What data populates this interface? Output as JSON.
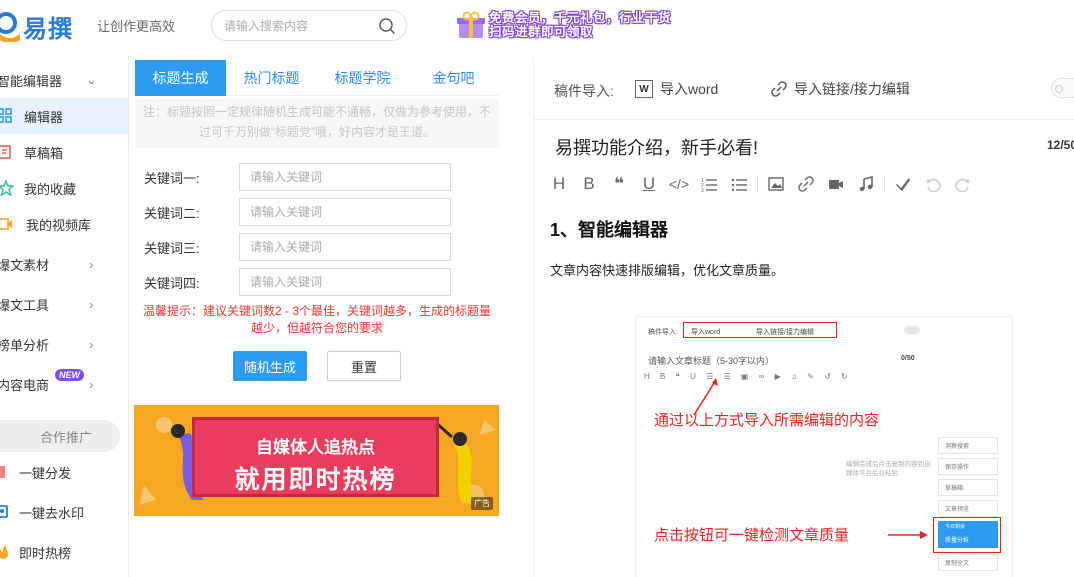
{
  "header": {
    "logo_text": "易撰",
    "slogan": "让创作更高效",
    "search_placeholder": "请输入搜索内容",
    "promo_line1": "免费会员，千元礼包，行业干货",
    "promo_line2": "扫码进群即可领取"
  },
  "sidebar": {
    "items": [
      {
        "label": "智能编辑器"
      },
      {
        "label": "编辑器"
      },
      {
        "label": "草稿箱"
      },
      {
        "label": "我的收藏"
      },
      {
        "label": "我的视频库"
      },
      {
        "label": "爆文素材"
      },
      {
        "label": "爆文工具"
      },
      {
        "label": "榜单分析"
      },
      {
        "label": "内容电商"
      }
    ],
    "new_badge": "NEW",
    "coop_label": "合作推广",
    "promo_items": [
      {
        "label": "一键分发"
      },
      {
        "label": "一键去水印"
      },
      {
        "label": "即时热榜"
      }
    ]
  },
  "title_tool": {
    "tabs": [
      {
        "label": "标题生成"
      },
      {
        "label": "热门标题"
      },
      {
        "label": "标题学院"
      },
      {
        "label": "金句吧"
      }
    ],
    "notice": "注：标题按照一定规律随机生成可能不通畅，仅做为参考使用，不过可千万别做“标题党”哦，好内容才是王道。",
    "keywords": [
      {
        "label": "关键词一:",
        "placeholder": "请输入关键词"
      },
      {
        "label": "关键词二:",
        "placeholder": "请输入关键词"
      },
      {
        "label": "关键词三:",
        "placeholder": "请输入关键词"
      },
      {
        "label": "关键词四:",
        "placeholder": "请输入关键词"
      }
    ],
    "tip": "温馨提示：建议关键词数2 - 3个最佳，关键词越多，生成的标题量越少，但越符合您的要求",
    "generate_label": "随机生成",
    "reset_label": "重置"
  },
  "ad": {
    "line1": "自媒体人追热点",
    "line2": "就用即时热榜",
    "tag": "广告"
  },
  "editor": {
    "import_label": "稿件导入:",
    "word_icon": "W",
    "word_label": "导入word",
    "link_label": "导入链接/接力编辑",
    "doc_title": "易撰功能介绍，新手必看!",
    "char_count": "12/50",
    "toolbar": [
      "H",
      "B",
      "❝",
      "U",
      "</>",
      "ordered-list-icon",
      "bullet-list-icon",
      "image-icon",
      "link-icon",
      "video-icon",
      "music-icon",
      "brush-icon",
      "undo-icon",
      "redo-icon"
    ],
    "heading": "1、智能编辑器",
    "paragraph": "文章内容快速排版编辑，优化文章质量。"
  },
  "figure": {
    "import_label": "稿件导入:",
    "word_label": "导入word",
    "link_label": "导入链接/接力编辑",
    "title_placeholder": "请输入文章标题（5-30字以内）",
    "count": "0/50",
    "caption1": "通过以上方式导入所需编辑的内容",
    "caption2": "点击按钮可一键检测文章质量",
    "hint": "编辑完成后点击复制内容到自媒体平台后台粘贴",
    "menu": [
      "洞察搜索",
      "保存操作",
      "草稿箱",
      "文章预览",
      "今日剩余",
      "质量分析",
      "复制全文"
    ]
  },
  "colors": {
    "accent": "#2d9cf0",
    "warning": "#e33333",
    "ad_bg": "#f5a623",
    "ad_board": "#ea3c5c"
  }
}
